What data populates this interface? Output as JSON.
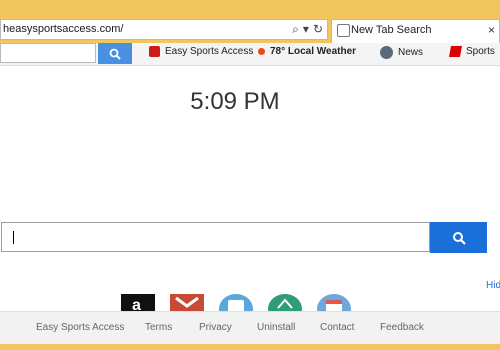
{
  "browser": {
    "url": "heasysportsaccess.com/",
    "tab_label": "New Tab Search",
    "colors": {
      "frame": "#f2c65f",
      "accent": "#1a6fd9"
    }
  },
  "toolbar": {
    "items": [
      {
        "label": "Easy Sports Access",
        "icon": "sports-logo-icon"
      },
      {
        "label": "78° Local Weather",
        "icon": "weather-icon"
      },
      {
        "label": "News",
        "icon": "news-icon"
      },
      {
        "label": "Sports",
        "icon": "espn-icon"
      }
    ]
  },
  "main": {
    "time": "5:09 PM",
    "hide_link": "Hid",
    "tiles": [
      "amazon-icon",
      "gmail-icon",
      "chat-icon",
      "maps-icon",
      "calendar-icon"
    ]
  },
  "footer": {
    "links": [
      "Easy Sports Access",
      "Terms",
      "Privacy",
      "Uninstall",
      "Contact",
      "Feedback"
    ]
  }
}
